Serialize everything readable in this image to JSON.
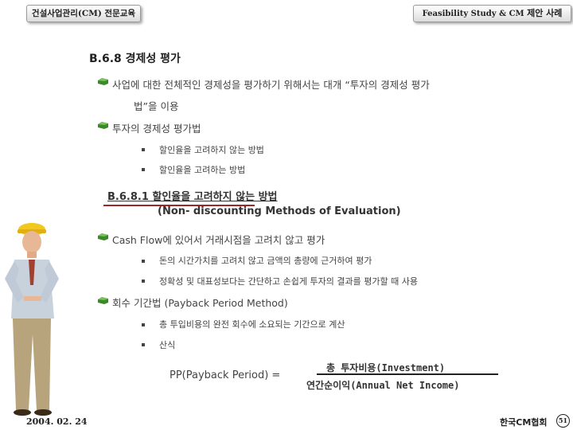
{
  "header": {
    "left_tab": "건설사업관리(CM) 전문교육",
    "right_tab_en": "Feasibility Study & CM ",
    "right_tab_ko": "제안 사례"
  },
  "heading": "B.6.8 경제성 평가",
  "bullets": [
    {
      "text_line1": "사업에 대한 전체적인 경제성을 평가하기 위해서는 대개 “투자의 경제성 평가",
      "text_line2": "법”을 이용"
    },
    {
      "text": "투자의 경제성 평가법",
      "sub": [
        "할인율을 고려하지 않는 방법",
        "할인율을 고려하는 방법"
      ]
    }
  ],
  "subsection": {
    "title": "B.6.8.1 할인율을 고려하지 않는 방법",
    "subtitle": "(Non- discounting Methods of Evaluation)"
  },
  "bullets2": [
    {
      "text": "Cash Flow에 있어서 거래시점을 고려치 않고 평가",
      "sub": [
        "돈의 시간가치를 고려치 않고 금액의 총량에 근거하여 평가",
        "정확성 및 대표성보다는 간단하고 손쉽게 투자의 결과를 평가할 때 사용"
      ]
    },
    {
      "text": "회수 기간법 (Payback Period Method)",
      "sub": [
        "총 투입비용의 완전 회수에 소요되는 기간으로 계산",
        "산식"
      ]
    }
  ],
  "formula": {
    "left": "PP(Payback Period) =",
    "numerator": "총 투자비용(Investment)",
    "denominator": "연간순이익(Annual Net Income)"
  },
  "footer": {
    "date": "2004. 02. 24",
    "org": "한국CM협회",
    "page": "51"
  },
  "colors": {
    "bullet_green": "#3a8a2a",
    "underline_red": "#a0242a"
  },
  "icons": {
    "bullet": "green-bullet-icon",
    "figure": "construction-worker-illustration"
  }
}
